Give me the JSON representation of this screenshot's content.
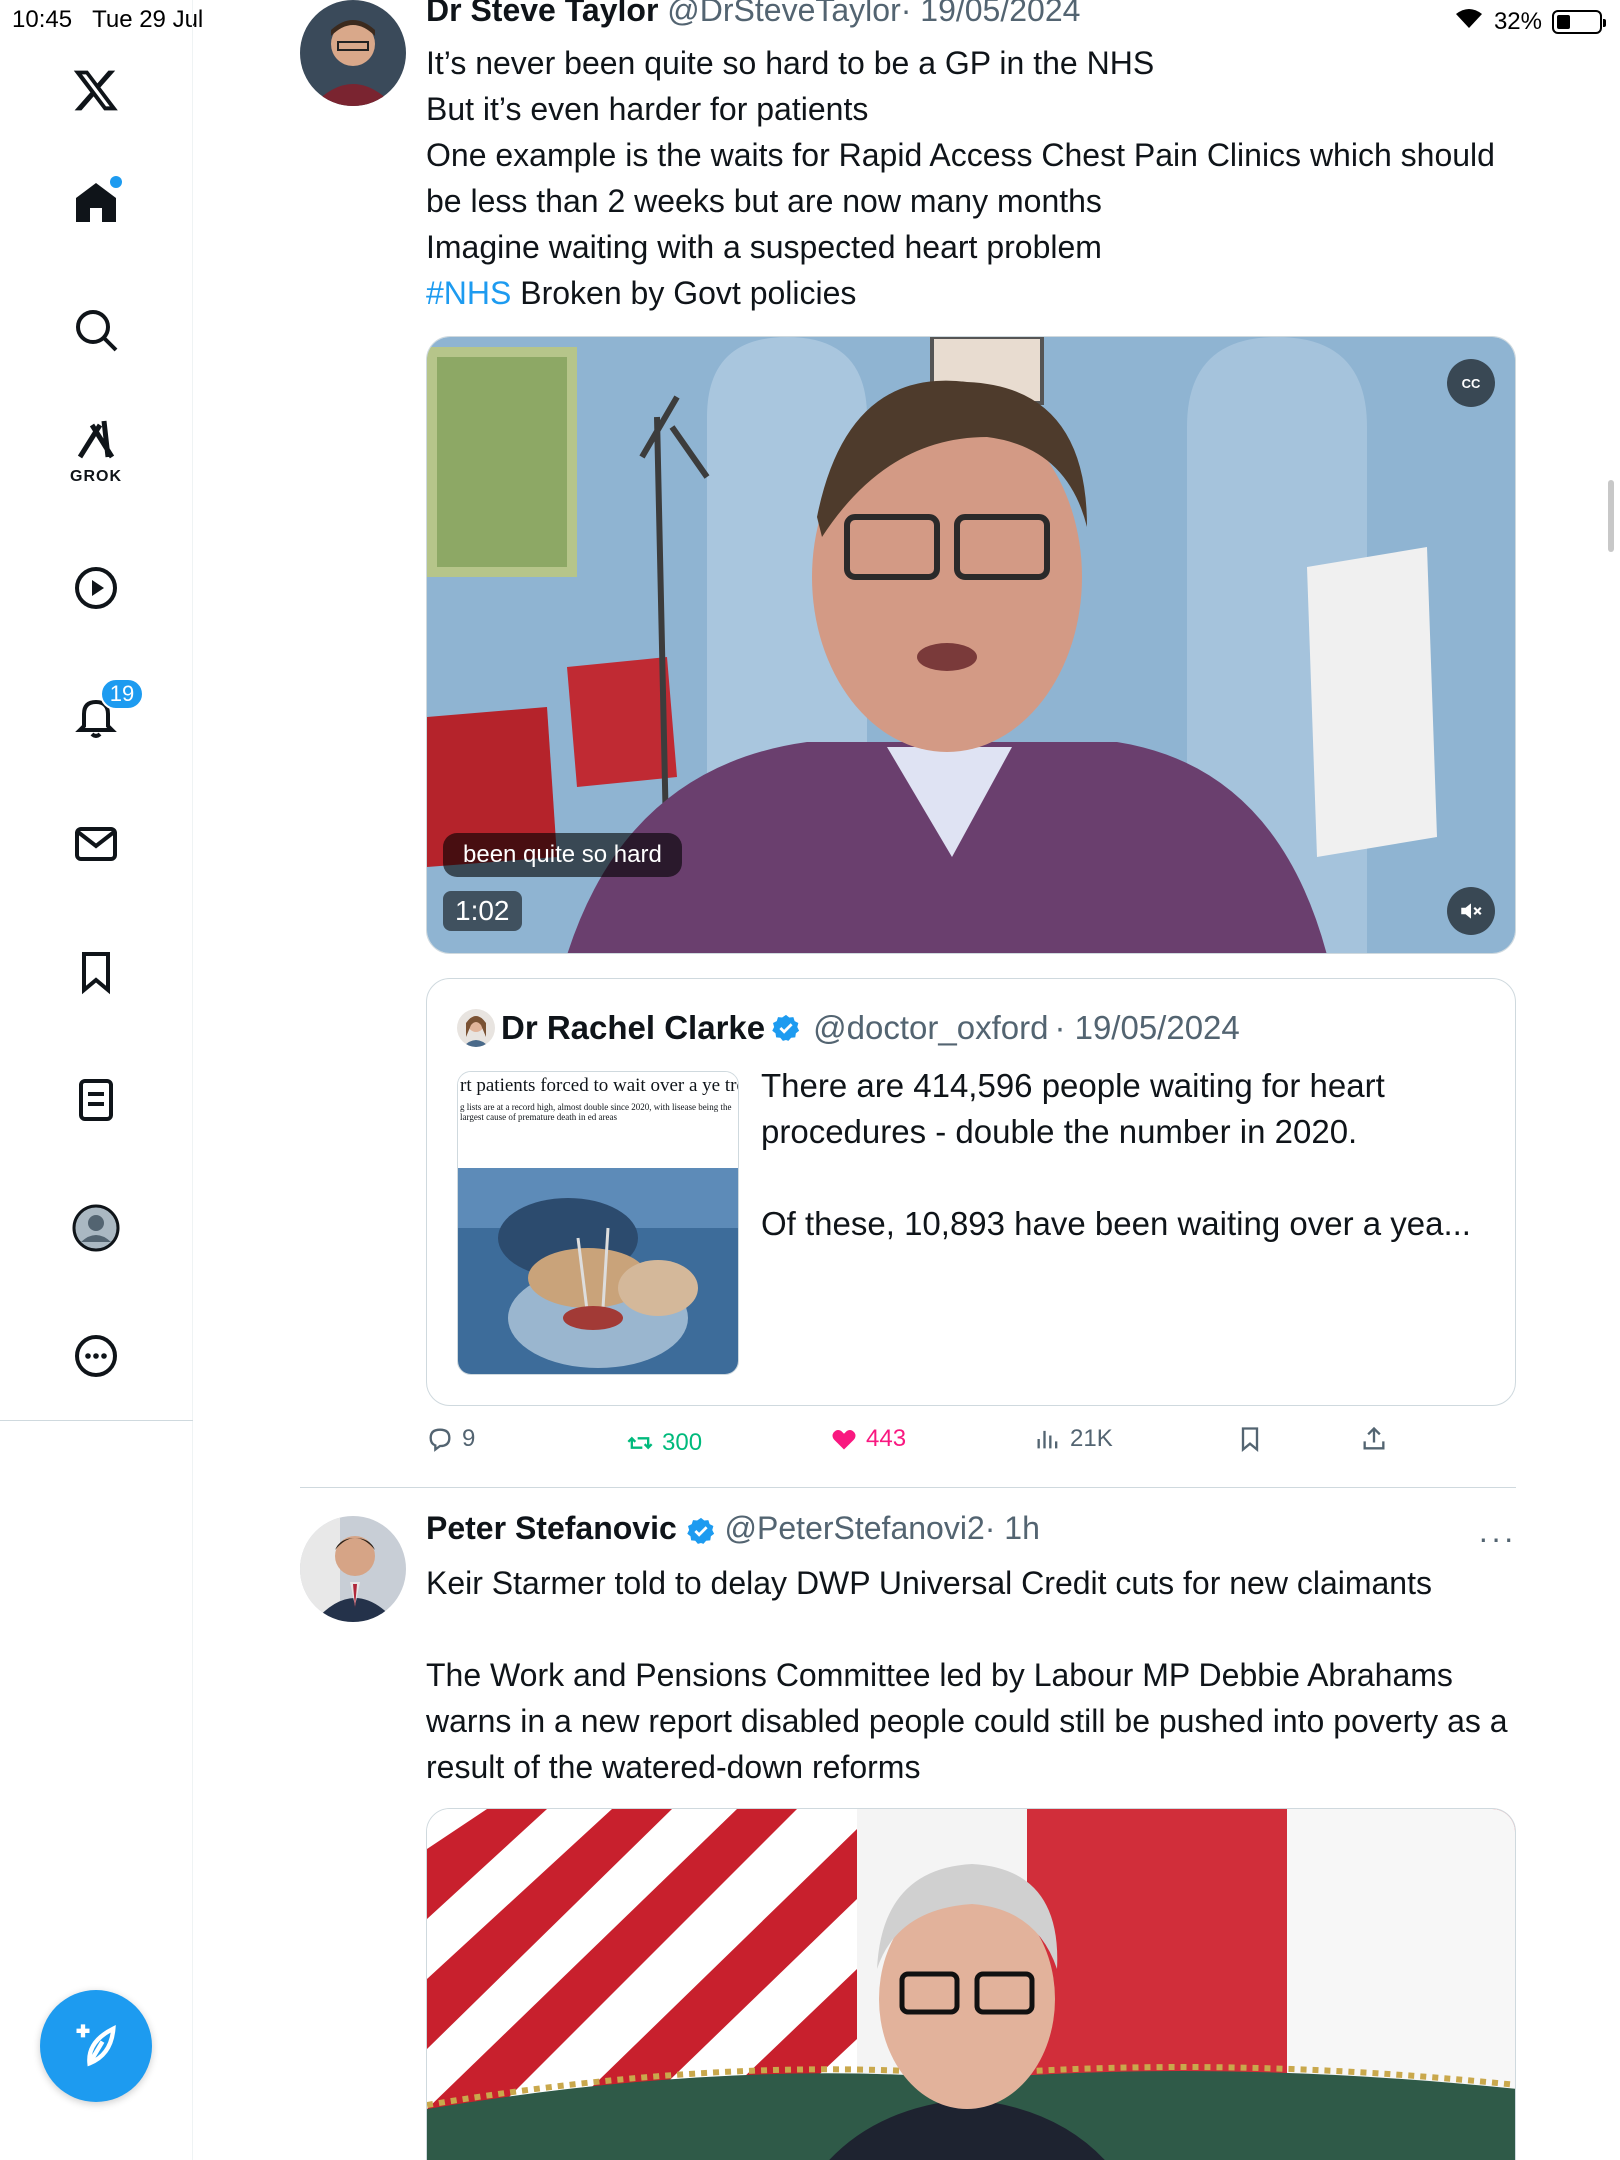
{
  "status_bar": {
    "time": "10:45",
    "date": "Tue 29 Jul",
    "battery": "32%",
    "battery_level": 0.32
  },
  "sidebar": {
    "grok_label": "GROK",
    "notifications_count": "19",
    "icons": [
      "x-logo-icon",
      "home-icon",
      "search-icon",
      "grok-icon",
      "video-icon",
      "bell-icon",
      "mail-icon",
      "bookmark-icon",
      "lists-icon",
      "profile-icon",
      "more-icon",
      "compose-icon"
    ]
  },
  "tweet1": {
    "name": "Dr Steve Taylor",
    "handle": "@DrSteveTaylor",
    "date": "· 19/05/2024",
    "lines": [
      "It’s never been quite so hard to be a GP in the NHS",
      "But it’s even harder for patients",
      "One example is the waits for Rapid Access Chest Pain Clinics which should be less than 2 weeks but are now many months",
      "Imagine waiting with a suspected heart problem"
    ],
    "hashtag": "#NHS",
    "last_line_rest": " Broken by Govt policies",
    "video": {
      "cc_label": "CC",
      "caption": "been quite so hard",
      "duration": "1:02"
    },
    "quote": {
      "name": "Dr Rachel Clarke",
      "handle": "@doctor_oxford",
      "date": "· 19/05/2024",
      "text_line1": "There are 414,596 people waiting for heart procedures - double the number in 2020.",
      "text_line2": "Of these, 10,893 have been waiting over a yea...",
      "thumb_headline": "rt patients forced to wait over a ye treatment in England",
      "thumb_subtext": "g lists are at a record high, almost double since 2020, with lisease being the largest cause of premature death in ed areas"
    },
    "actions": {
      "replies": "9",
      "reposts": "300",
      "likes": "443",
      "views": "21K"
    }
  },
  "tweet2": {
    "name": "Peter Stefanovic",
    "handle": "@PeterStefanovi2",
    "time": "· 1h",
    "more": "···",
    "paragraphs": [
      "Keir Starmer told to delay DWP Universal Credit cuts for new claimants",
      "",
      "The Work and Pensions Committee led by Labour MP Debbie Abrahams warns in a new report disabled people could still be pushed into poverty as a result of the watered-down reforms"
    ]
  },
  "colors": {
    "accent": "#1d9bf0",
    "like": "#f91880",
    "repost": "#00ba7c",
    "secondary": "#536471"
  }
}
